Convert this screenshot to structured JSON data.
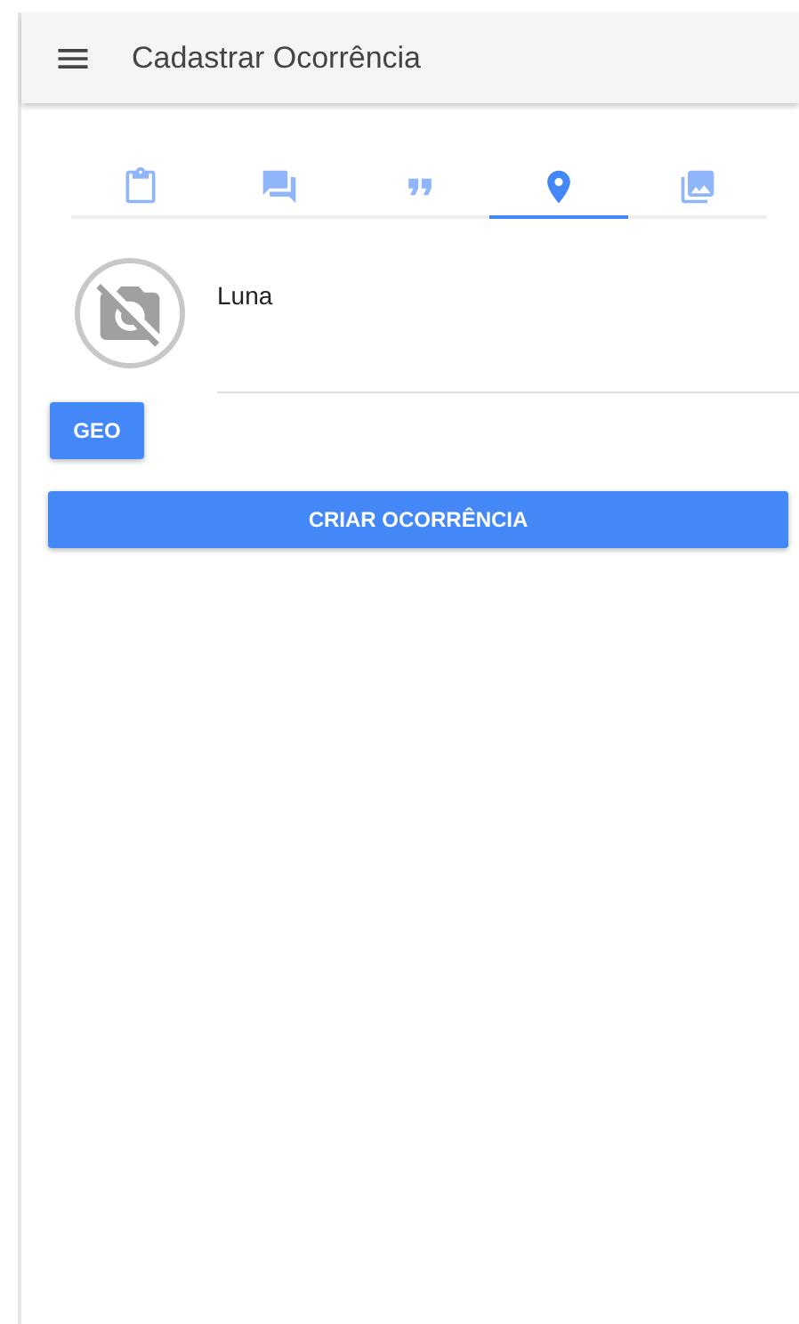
{
  "app_bar": {
    "title": "Cadastrar Ocorrência"
  },
  "tabs": [
    {
      "kind": "details",
      "selected": false
    },
    {
      "kind": "chat",
      "selected": false
    },
    {
      "kind": "quote",
      "selected": false
    },
    {
      "kind": "location",
      "selected": true
    },
    {
      "kind": "photos",
      "selected": false
    }
  ],
  "form": {
    "name_field": {
      "value": "Luna"
    },
    "geo_button": "GEO",
    "submit_button": "CRIAR OCORRÊNCIA"
  }
}
